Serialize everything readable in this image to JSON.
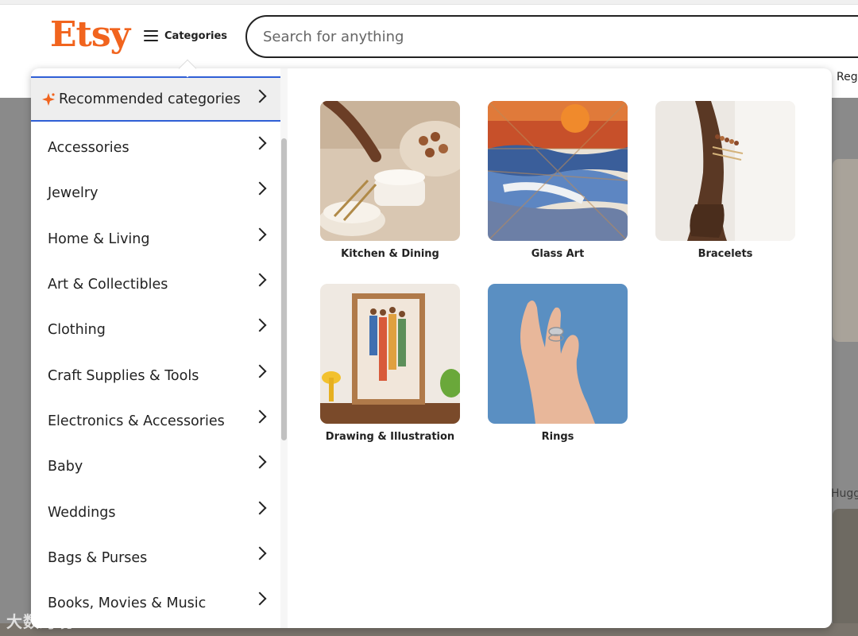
{
  "header": {
    "logo": "Etsy",
    "categories_label": "Categories",
    "search_placeholder": "Search for anything",
    "right_link": "Reg"
  },
  "dropdown": {
    "sidebar": [
      {
        "label": "Recommended categories",
        "active": true
      },
      {
        "label": "Accessories"
      },
      {
        "label": "Jewelry"
      },
      {
        "label": "Home & Living"
      },
      {
        "label": "Art & Collectibles"
      },
      {
        "label": "Clothing"
      },
      {
        "label": "Craft Supplies & Tools"
      },
      {
        "label": "Electronics & Accessories"
      },
      {
        "label": "Baby"
      },
      {
        "label": "Weddings"
      },
      {
        "label": "Bags & Purses"
      },
      {
        "label": "Books, Movies & Music"
      }
    ],
    "recommended": [
      {
        "label": "Kitchen & Dining"
      },
      {
        "label": "Glass Art"
      },
      {
        "label": "Bracelets"
      },
      {
        "label": "Drawing & Illustration"
      },
      {
        "label": "Rings"
      }
    ]
  },
  "background": {
    "partial_text": "Hugg"
  },
  "watermark": "大数跨境",
  "colors": {
    "brand": "#f1641e",
    "active_border": "#2f5fd6"
  }
}
